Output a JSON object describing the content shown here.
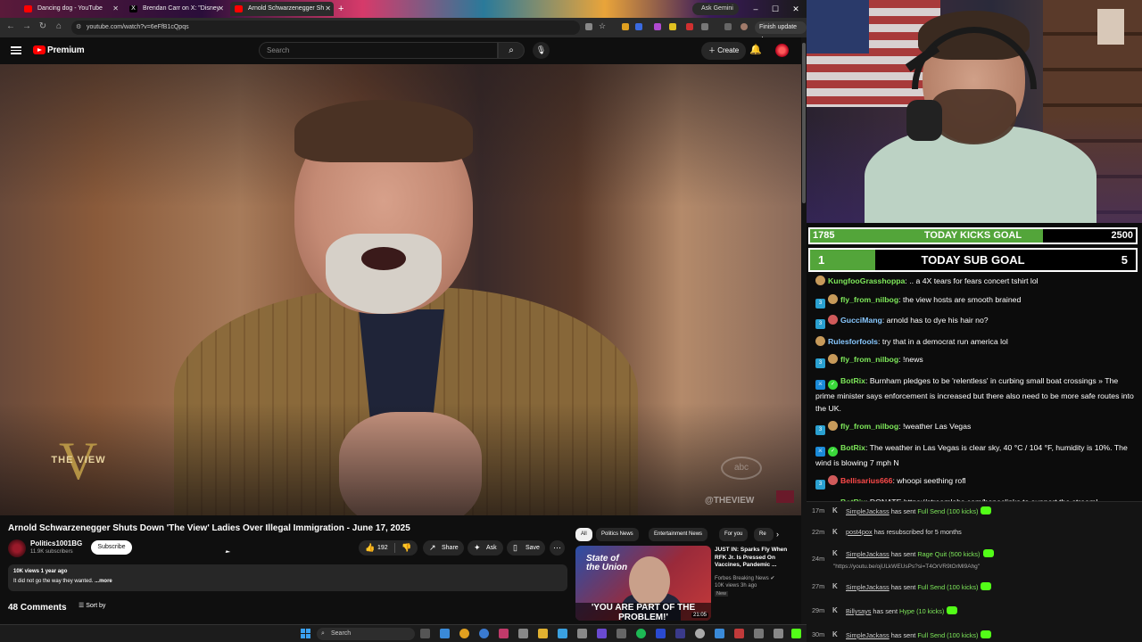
{
  "browser": {
    "tabs": [
      {
        "title": "Dancing dog - YouTube",
        "favicon_color": "#ff0000"
      },
      {
        "title": "Brendan Carr on X: \"Disney",
        "favicon_color": "#000000"
      },
      {
        "title": "Arnold Schwarzenegger Sh",
        "favicon_color": "#ff0000"
      }
    ],
    "ask_gemini": "Ask Gemini",
    "url": "youtube.com/watch?v=6eFfB1cQpqs",
    "finish_update": "Finish update"
  },
  "youtube": {
    "brand": "Premium",
    "search_placeholder": "Search",
    "create_label": "Create",
    "video": {
      "title": "Arnold Schwarzenegger Shuts Down 'The View' Ladies Over Illegal Immigration - June 17, 2025",
      "overlay_logo": "THE VIEW",
      "watermark": "@THEVIEW"
    },
    "channel": {
      "name": "Politics1001BG",
      "subscribers": "11.9K subscribers",
      "subscribe_label": "Subscribe"
    },
    "actions": {
      "likes": "192",
      "share": "Share",
      "ask": "Ask",
      "save": "Save"
    },
    "description": {
      "stats": "10K views  1 year ago",
      "text": "It did not go the way they wanted.",
      "more": "...more"
    },
    "comments": {
      "count_label": "48 Comments",
      "sort_label": "Sort by"
    },
    "chips": [
      "All",
      "Politics News",
      "Entertainment News",
      "For you",
      "Re"
    ],
    "recommendation": {
      "title": "JUST IN: Sparks Fly When RFK Jr. Is Pressed On Vaccines, Pandemic ...",
      "channel": "Forbes Breaking News",
      "meta": "10K views  3h ago",
      "badge": "New",
      "duration": "21:05",
      "thumb_logo": "State of the Union",
      "thumb_caption": "'YOU ARE PART OF THE PROBLEM!'"
    }
  },
  "taskbar": {
    "search_label": "Search"
  },
  "stream": {
    "kicks_goal": {
      "current": "1785",
      "label": "TODAY KICKS GOAL",
      "target": "2500",
      "progress": 0.714
    },
    "sub_goal": {
      "current": "1",
      "label": "TODAY SUB GOAL",
      "target": "5",
      "progress": 0.2
    },
    "chat": [
      {
        "user": "KungfooGrasshoppa",
        "text": ".. a 4X tears for fears concert tshirt lol"
      },
      {
        "user": "fly_from_nilbog",
        "text": "the view hosts are smooth brained"
      },
      {
        "user": "GucciMang",
        "text": "arnold has to dye his hair no?"
      },
      {
        "user": "Rulesforfools",
        "text": "try that in a democrat run america lol"
      },
      {
        "user": "fly_from_nilbog",
        "text": "!news"
      },
      {
        "user": "BotRix",
        "text": "Burnham pledges to be 'relentless' in curbing small boat crossings » The prime minister says enforcement is increased but there also need to be more safe routes into the UK."
      },
      {
        "user": "fly_from_nilbog",
        "text": "!weather Las Vegas"
      },
      {
        "user": "BotRix",
        "text": "The weather in Las Vegas is clear sky, 40 °C / 104 °F, humidity is 10%. The wind is blowing 7 mph N"
      },
      {
        "user": "Bellisarius666",
        "text": "whoopi seething rofl"
      },
      {
        "user": "BotRix",
        "text": "DONATE",
        "link": "https://streamlabs.com/boneclinks",
        "text_after": "to support the stream!"
      }
    ],
    "events": [
      {
        "time": "17m",
        "name": "SimpleJackass",
        "action": "has sent",
        "item": "Full Send (100 kicks)"
      },
      {
        "time": "22m",
        "name": "post4pox",
        "action": "has resubscribed for 5 months",
        "item": ""
      },
      {
        "time": "24m",
        "name": "SimpleJackass",
        "action": "has sent",
        "item": "Rage Quit (500 kicks)",
        "note": "\"https://youtu.be/ojULkWEUsPs?si=T4OrVR9tOrMl9Ahg\""
      },
      {
        "time": "27m",
        "name": "SimpleJackass",
        "action": "has sent",
        "item": "Full Send (100 kicks)"
      },
      {
        "time": "29m",
        "name": "Billysays",
        "action": "has sent",
        "item": "Hype (10 kicks)"
      },
      {
        "time": "30m",
        "name": "SimpleJackass",
        "action": "has sent",
        "item": "Full Send (100 kicks)"
      }
    ]
  }
}
